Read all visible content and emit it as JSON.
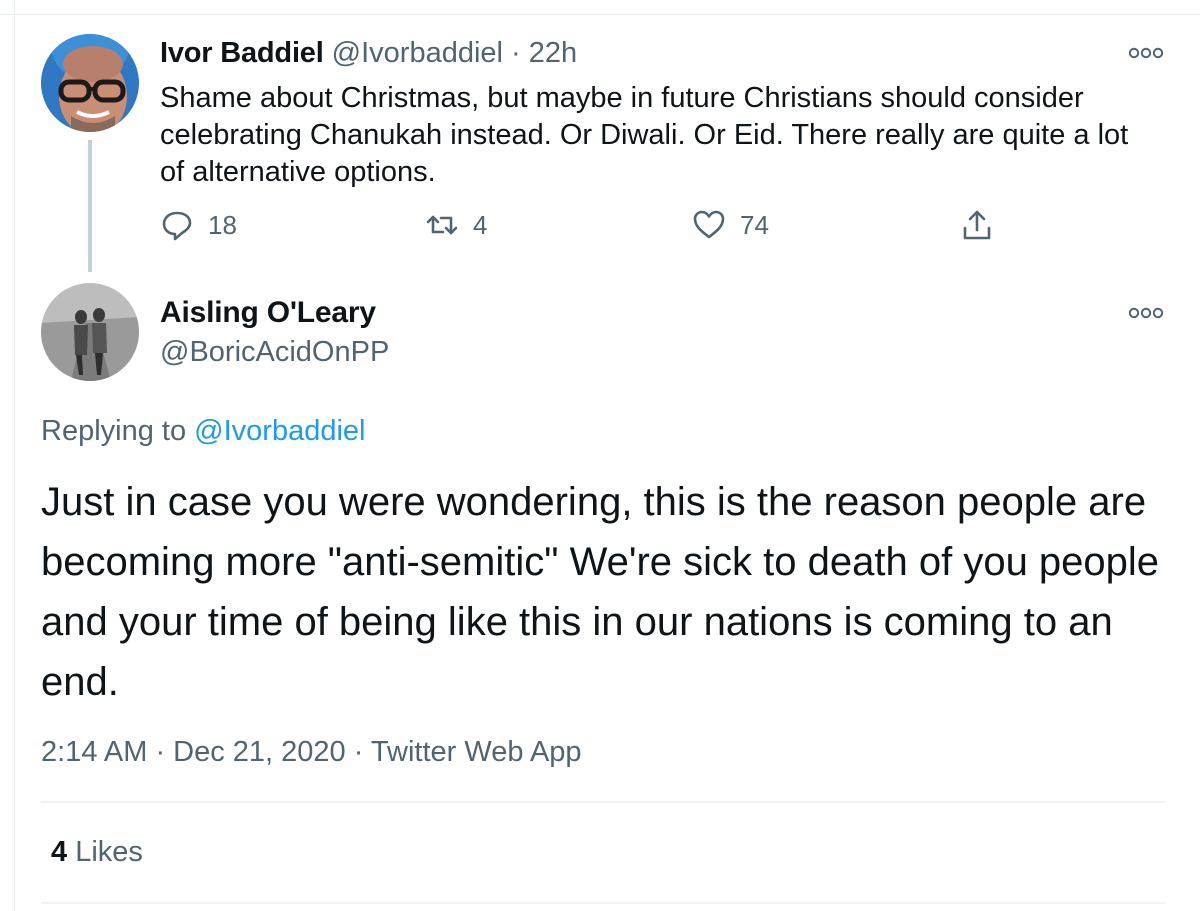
{
  "tweet1": {
    "name": "Ivor Baddiel",
    "handle": "@Ivorbaddiel",
    "separator": "·",
    "time": "22h",
    "text": "Shame about Christmas, but maybe in future Christians should consider celebrating Chanukah instead. Or Diwali. Or Eid. There really are quite a lot of alternative options.",
    "replies": "18",
    "retweets": "4",
    "likes": "74"
  },
  "tweet2": {
    "name": "Aisling O'Leary",
    "handle": "@BoricAcidOnPP",
    "replying_prefix": "Replying to",
    "replying_to": "@Ivorbaddiel",
    "text": "Just in case you were wondering, this is the reason people are becoming more \"anti-semitic\" We're sick to death of you people and your time of being like this in our nations is coming to an end.",
    "timestamp": "2:14 AM · Dec 21, 2020 · Twitter Web App",
    "likes_count": "4",
    "likes_label": "Likes"
  },
  "colors": {
    "text": "#0f1419",
    "muted": "#536471",
    "link": "#1d9bf0",
    "divider": "#eff3f4",
    "thread_line": "#c4cfd6"
  },
  "icons": {
    "reply": "reply-icon",
    "retweet": "retweet-icon",
    "like": "heart-icon",
    "share": "share-icon",
    "more": "more-icon"
  }
}
